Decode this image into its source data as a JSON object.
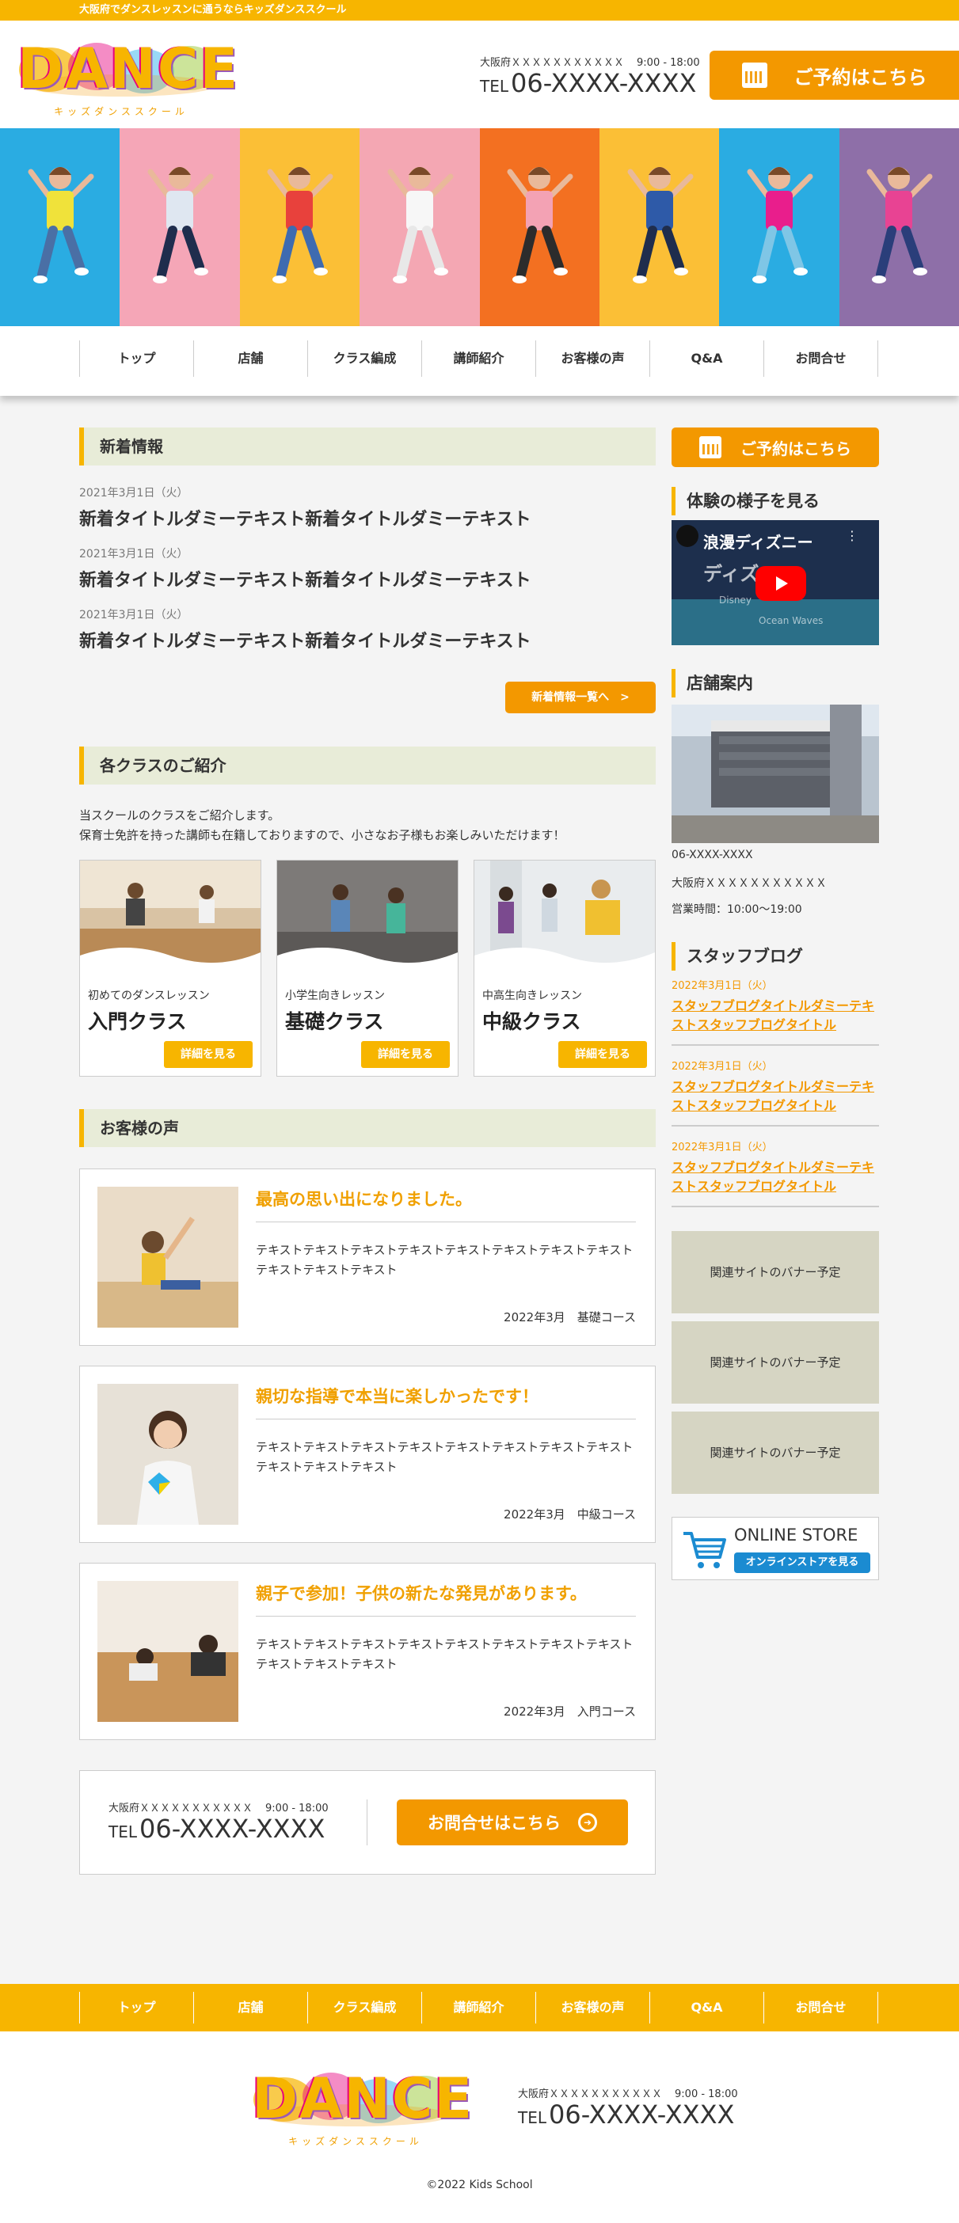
{
  "topbar": {
    "text": "大阪府でダンスレッスンに通うならキッズダンススクール"
  },
  "logo": {
    "word": "DANCE",
    "sub": "キッズダンススクール"
  },
  "header": {
    "address": "大阪府ＸＸＸＸＸＸＸＸＸＸＸ",
    "hours": "9:00 - 18:00",
    "tel_prefix": "TEL",
    "tel": "06-XXXX-XXXX",
    "reserve_label": "ご予約はこちら"
  },
  "colors": {
    "accent": "#f7b500",
    "orange": "#f39800",
    "title_bg": "#e8ecd8",
    "banner_bg": "#d6d5c3",
    "youtube_red": "#ff0000"
  },
  "hero": {
    "panel_colors": [
      "#2aace2",
      "#f5a6b7",
      "#fbbf36",
      "#f4a7b3",
      "#f37021",
      "#fbbf36",
      "#2aace2",
      "#8e6fa8"
    ]
  },
  "nav": [
    "トップ",
    "店舗",
    "クラス編成",
    "講師紹介",
    "お客様の声",
    "Q&A",
    "お問合せ"
  ],
  "news": {
    "title": "新着情報",
    "items": [
      {
        "date": "2021年3月1日（火）",
        "title": "新着タイトルダミーテキスト新着タイトルダミーテキスト"
      },
      {
        "date": "2021年3月1日（火）",
        "title": "新着タイトルダミーテキスト新着タイトルダミーテキスト"
      },
      {
        "date": "2021年3月1日（火）",
        "title": "新着タイトルダミーテキスト新着タイトルダミーテキスト"
      }
    ],
    "more_label": "新着情報一覧へ　>"
  },
  "classes": {
    "title": "各クラスのご紹介",
    "intro1": "当スクールのクラスをご紹介します。",
    "intro2": "保育士免許を持った講師も在籍しておりますので、小さなお子様もお楽しみいただけます！",
    "items": [
      {
        "category": "初めてのダンスレッスン",
        "name": "入門クラス",
        "detail": "詳細を見る"
      },
      {
        "category": "小学生向きレッスン",
        "name": "基礎クラス",
        "detail": "詳細を見る"
      },
      {
        "category": "中高生向きレッスン",
        "name": "中級クラス",
        "detail": "詳細を見る"
      }
    ]
  },
  "voices": {
    "title": "お客様の声",
    "items": [
      {
        "title": "最高の思い出になりました。",
        "body": "テキストテキストテキストテキストテキストテキストテキストテキストテキストテキストテキスト",
        "meta": "2022年3月　基礎コース"
      },
      {
        "title": "親切な指導で本当に楽しかったです！",
        "body": "テキストテキストテキストテキストテキストテキストテキストテキストテキストテキストテキスト",
        "meta": "2022年3月　中級コース"
      },
      {
        "title": "親子で参加！子供の新たな発見があります。",
        "body": "テキストテキストテキストテキストテキストテキストテキストテキストテキストテキストテキスト",
        "meta": "2022年3月　入門コース"
      }
    ]
  },
  "contact": {
    "address": "大阪府ＸＸＸＸＸＸＸＸＸＸＸ",
    "hours": "9:00 - 18:00",
    "tel_prefix": "TEL",
    "tel": "06-XXXX-XXXX",
    "button": "お問合せはこちら"
  },
  "sidebar": {
    "reserve_label": "ご予約はこちら",
    "video_title": "体験の様子を見る",
    "video_overlay": "浪漫ディズニー",
    "video_line2": "ディズ",
    "video_line3": "Disney",
    "video_line4": "Ocean Waves",
    "shop_title": "店舗案内",
    "shop_tel": "06-XXXX-XXXX",
    "shop_address": "大阪府ＸＸＸＸＸＸＸＸＸＸＸ",
    "shop_hours": "営業時間：10:00〜19:00",
    "blog_title": "スタッフブログ",
    "blog": [
      {
        "date": "2022年3月1日（火）",
        "title": "スタッフブログタイトルダミーテキストスタッフブログタイトル"
      },
      {
        "date": "2022年3月1日（火）",
        "title": "スタッフブログタイトルダミーテキストスタッフブログタイトル"
      },
      {
        "date": "2022年3月1日（火）",
        "title": "スタッフブログタイトルダミーテキストスタッフブログタイトル"
      }
    ],
    "banners": [
      "関連サイトのバナー予定",
      "関連サイトのバナー予定",
      "関連サイトのバナー予定"
    ],
    "store_title": "ONLINE STORE",
    "store_button": "オンラインストアを見る"
  },
  "footer": {
    "nav": [
      "トップ",
      "店舗",
      "クラス編成",
      "講師紹介",
      "お客様の声",
      "Q&A",
      "お問合せ"
    ],
    "address": "大阪府ＸＸＸＸＸＸＸＸＸＸＸ",
    "hours": "9:00 - 18:00",
    "tel_prefix": "TEL",
    "tel": "06-XXXX-XXXX",
    "copyright": "©2022 Kids School"
  }
}
